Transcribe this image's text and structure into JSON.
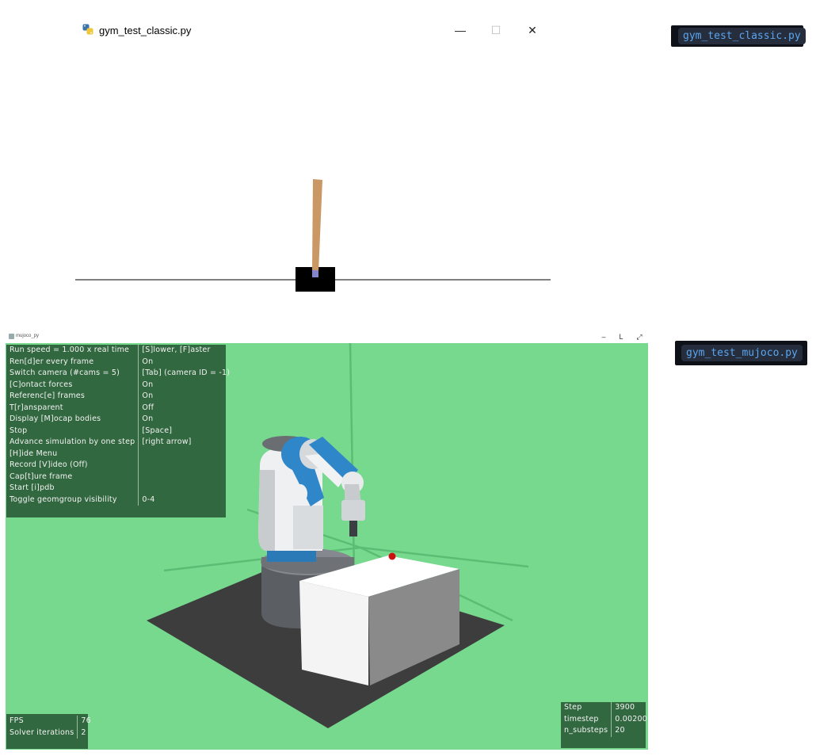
{
  "classic_window": {
    "title": "gym_test_classic.py",
    "icon": "python-icon",
    "controls": {
      "minimize": "—",
      "maximize": "☐",
      "close": "✕"
    },
    "scene": {
      "name": "cartpole",
      "cart_color": "#000000",
      "pole_color": "#ca9865",
      "axle_color": "#8184c9",
      "track_color": "#000000"
    }
  },
  "mujoco_window": {
    "title": "mujoco_py",
    "controls": {
      "minimize": "–",
      "maximize": "L",
      "close": "⤢"
    },
    "background_color": "#76d98e",
    "menu": [
      {
        "label": "Run speed = 1.000 x real time",
        "value": "[S]lower, [F]aster"
      },
      {
        "label": "Ren[d]er every frame",
        "value": "On"
      },
      {
        "label": "Switch camera (#cams = 5)",
        "value": "[Tab] (camera ID = -1)"
      },
      {
        "label": "[C]ontact forces",
        "value": "On"
      },
      {
        "label": "Referenc[e] frames",
        "value": "On"
      },
      {
        "label": "T[r]ansparent",
        "value": "Off"
      },
      {
        "label": "Display [M]ocap bodies",
        "value": "On"
      },
      {
        "label": "Stop",
        "value": "[Space]"
      },
      {
        "label": "Advance simulation by one step",
        "value": "[right arrow]"
      },
      {
        "label": "[H]ide Menu",
        "value": ""
      },
      {
        "label": "Record [V]ideo (Off)",
        "value": ""
      },
      {
        "label": "Cap[t]ure frame",
        "value": ""
      },
      {
        "label": "Start [i]pdb",
        "value": ""
      },
      {
        "label": "Toggle geomgroup visibility",
        "value": "0-4"
      }
    ],
    "stats_left": [
      {
        "label": "FPS",
        "value": "76"
      },
      {
        "label": "Solver iterations",
        "value": "2"
      }
    ],
    "stats_right": [
      {
        "label": "Step",
        "value": "3900"
      },
      {
        "label": "timestep",
        "value": "0.00200"
      },
      {
        "label": "n_substeps",
        "value": "20"
      }
    ]
  },
  "tags": {
    "classic": "gym_test_classic.py",
    "mujoco": "gym_test_mujoco.py"
  }
}
